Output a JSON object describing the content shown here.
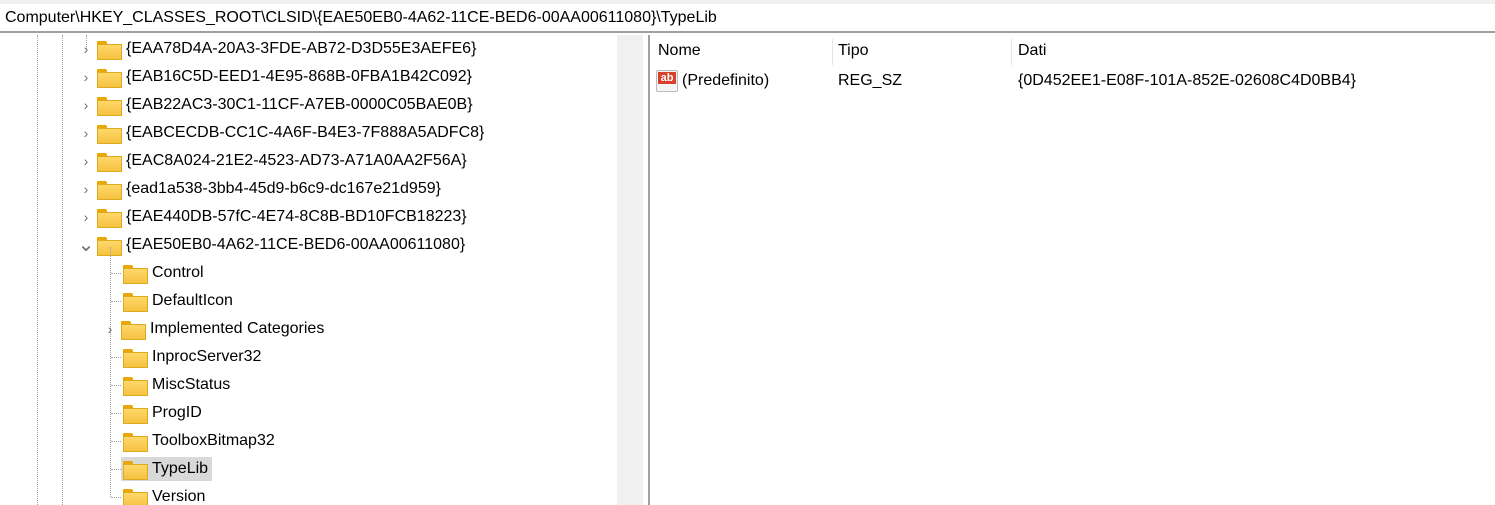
{
  "address_bar": {
    "path": "Computer\\HKEY_CLASSES_ROOT\\CLSID\\{EAE50EB0-4A62-11CE-BED6-00AA00611080}\\TypeLib"
  },
  "tree": {
    "siblings": [
      {
        "label": "{EAA78D4A-20A3-3FDE-AB72-D3D55E3AEFE6}",
        "expanded": false
      },
      {
        "label": "{EAB16C5D-EED1-4E95-868B-0FBA1B42C092}",
        "expanded": false
      },
      {
        "label": "{EAB22AC3-30C1-11CF-A7EB-0000C05BAE0B}",
        "expanded": false
      },
      {
        "label": "{EABCECDB-CC1C-4A6F-B4E3-7F888A5ADFC8}",
        "expanded": false
      },
      {
        "label": "{EAC8A024-21E2-4523-AD73-A71A0AA2F56A}",
        "expanded": false
      },
      {
        "label": "{ead1a538-3bb4-45d9-b6c9-dc167e21d959}",
        "expanded": false
      },
      {
        "label": "{EAE440DB-57fC-4E74-8C8B-BD10FCB18223}",
        "expanded": false
      },
      {
        "label": "{EAE50EB0-4A62-11CE-BED6-00AA00611080}",
        "expanded": true
      }
    ],
    "children": [
      {
        "label": "Control",
        "has_children": false
      },
      {
        "label": "DefaultIcon",
        "has_children": false
      },
      {
        "label": "Implemented Categories",
        "has_children": true
      },
      {
        "label": "InprocServer32",
        "has_children": false
      },
      {
        "label": "MiscStatus",
        "has_children": false
      },
      {
        "label": "ProgID",
        "has_children": false
      },
      {
        "label": "ToolboxBitmap32",
        "has_children": false
      },
      {
        "label": "TypeLib",
        "has_children": false,
        "selected": true
      },
      {
        "label": "Version",
        "has_children": false
      }
    ]
  },
  "values": {
    "columns": [
      "Nome",
      "Tipo",
      "Dati"
    ],
    "rows": [
      {
        "name": "(Predefinito)",
        "type": "REG_SZ",
        "data": "{0D452EE1-E08F-101A-852E-02608C4D0BB4}",
        "icon": "string-value-icon",
        "icon_text": "ab"
      }
    ]
  }
}
